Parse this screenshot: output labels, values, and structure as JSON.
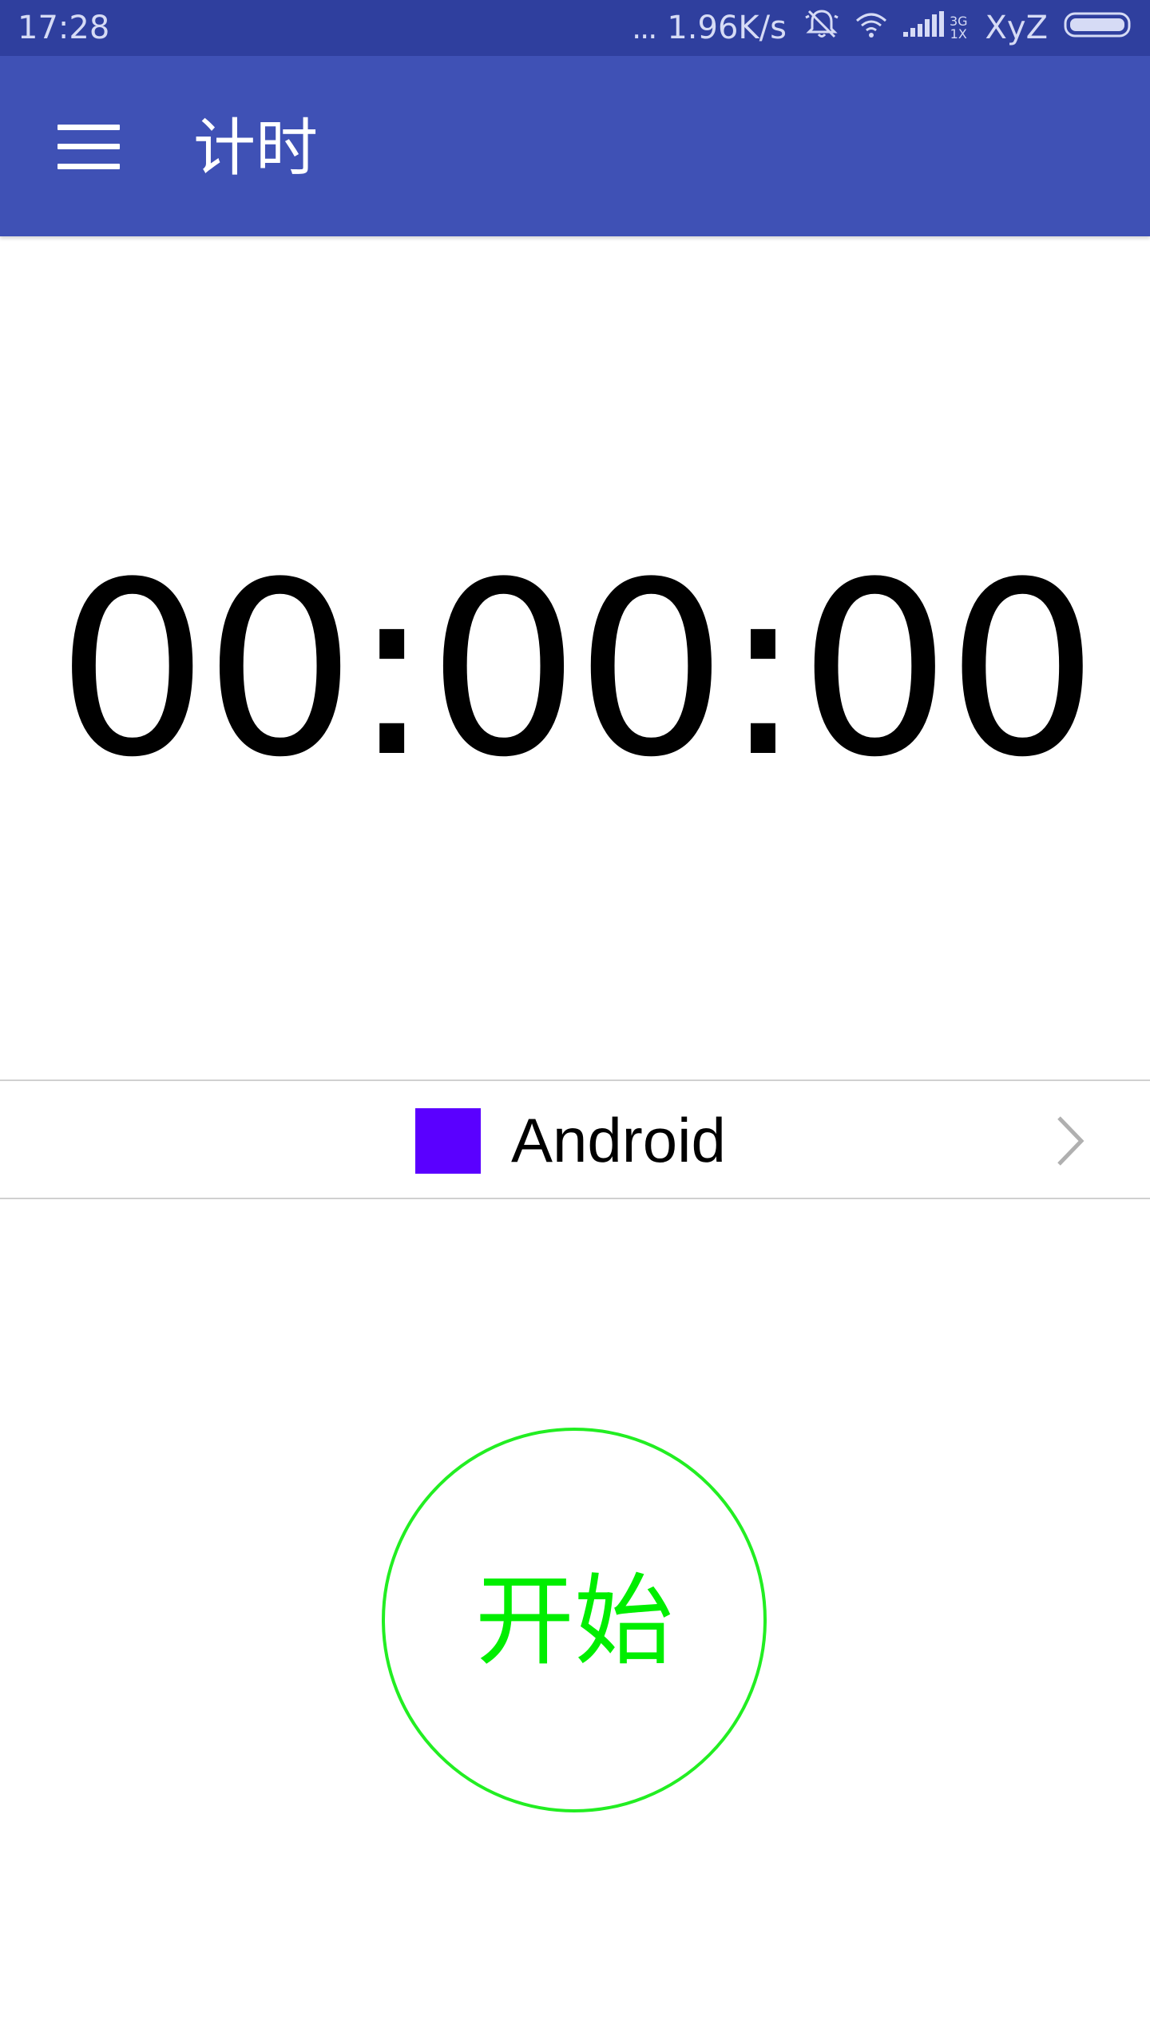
{
  "status_bar": {
    "time": "17:28",
    "more": "...",
    "net_speed": "1.96K/s",
    "net_type_top": "3G",
    "net_type_bottom": "1X",
    "carrier": "XyZ",
    "icons": [
      "mute-bell-icon",
      "wifi-icon",
      "signal-icon",
      "battery-icon"
    ],
    "color": "#2f3f9e"
  },
  "app_bar": {
    "title": "计时",
    "menu_icon": "hamburger-menu-icon",
    "color": "#3f51b5"
  },
  "timer": {
    "display": "00:00:00"
  },
  "selector": {
    "label": "Android",
    "swatch_color": "#5a00ff",
    "chevron_icon": "chevron-right-icon"
  },
  "start_button": {
    "label": "开始",
    "color": "#00ee00"
  }
}
